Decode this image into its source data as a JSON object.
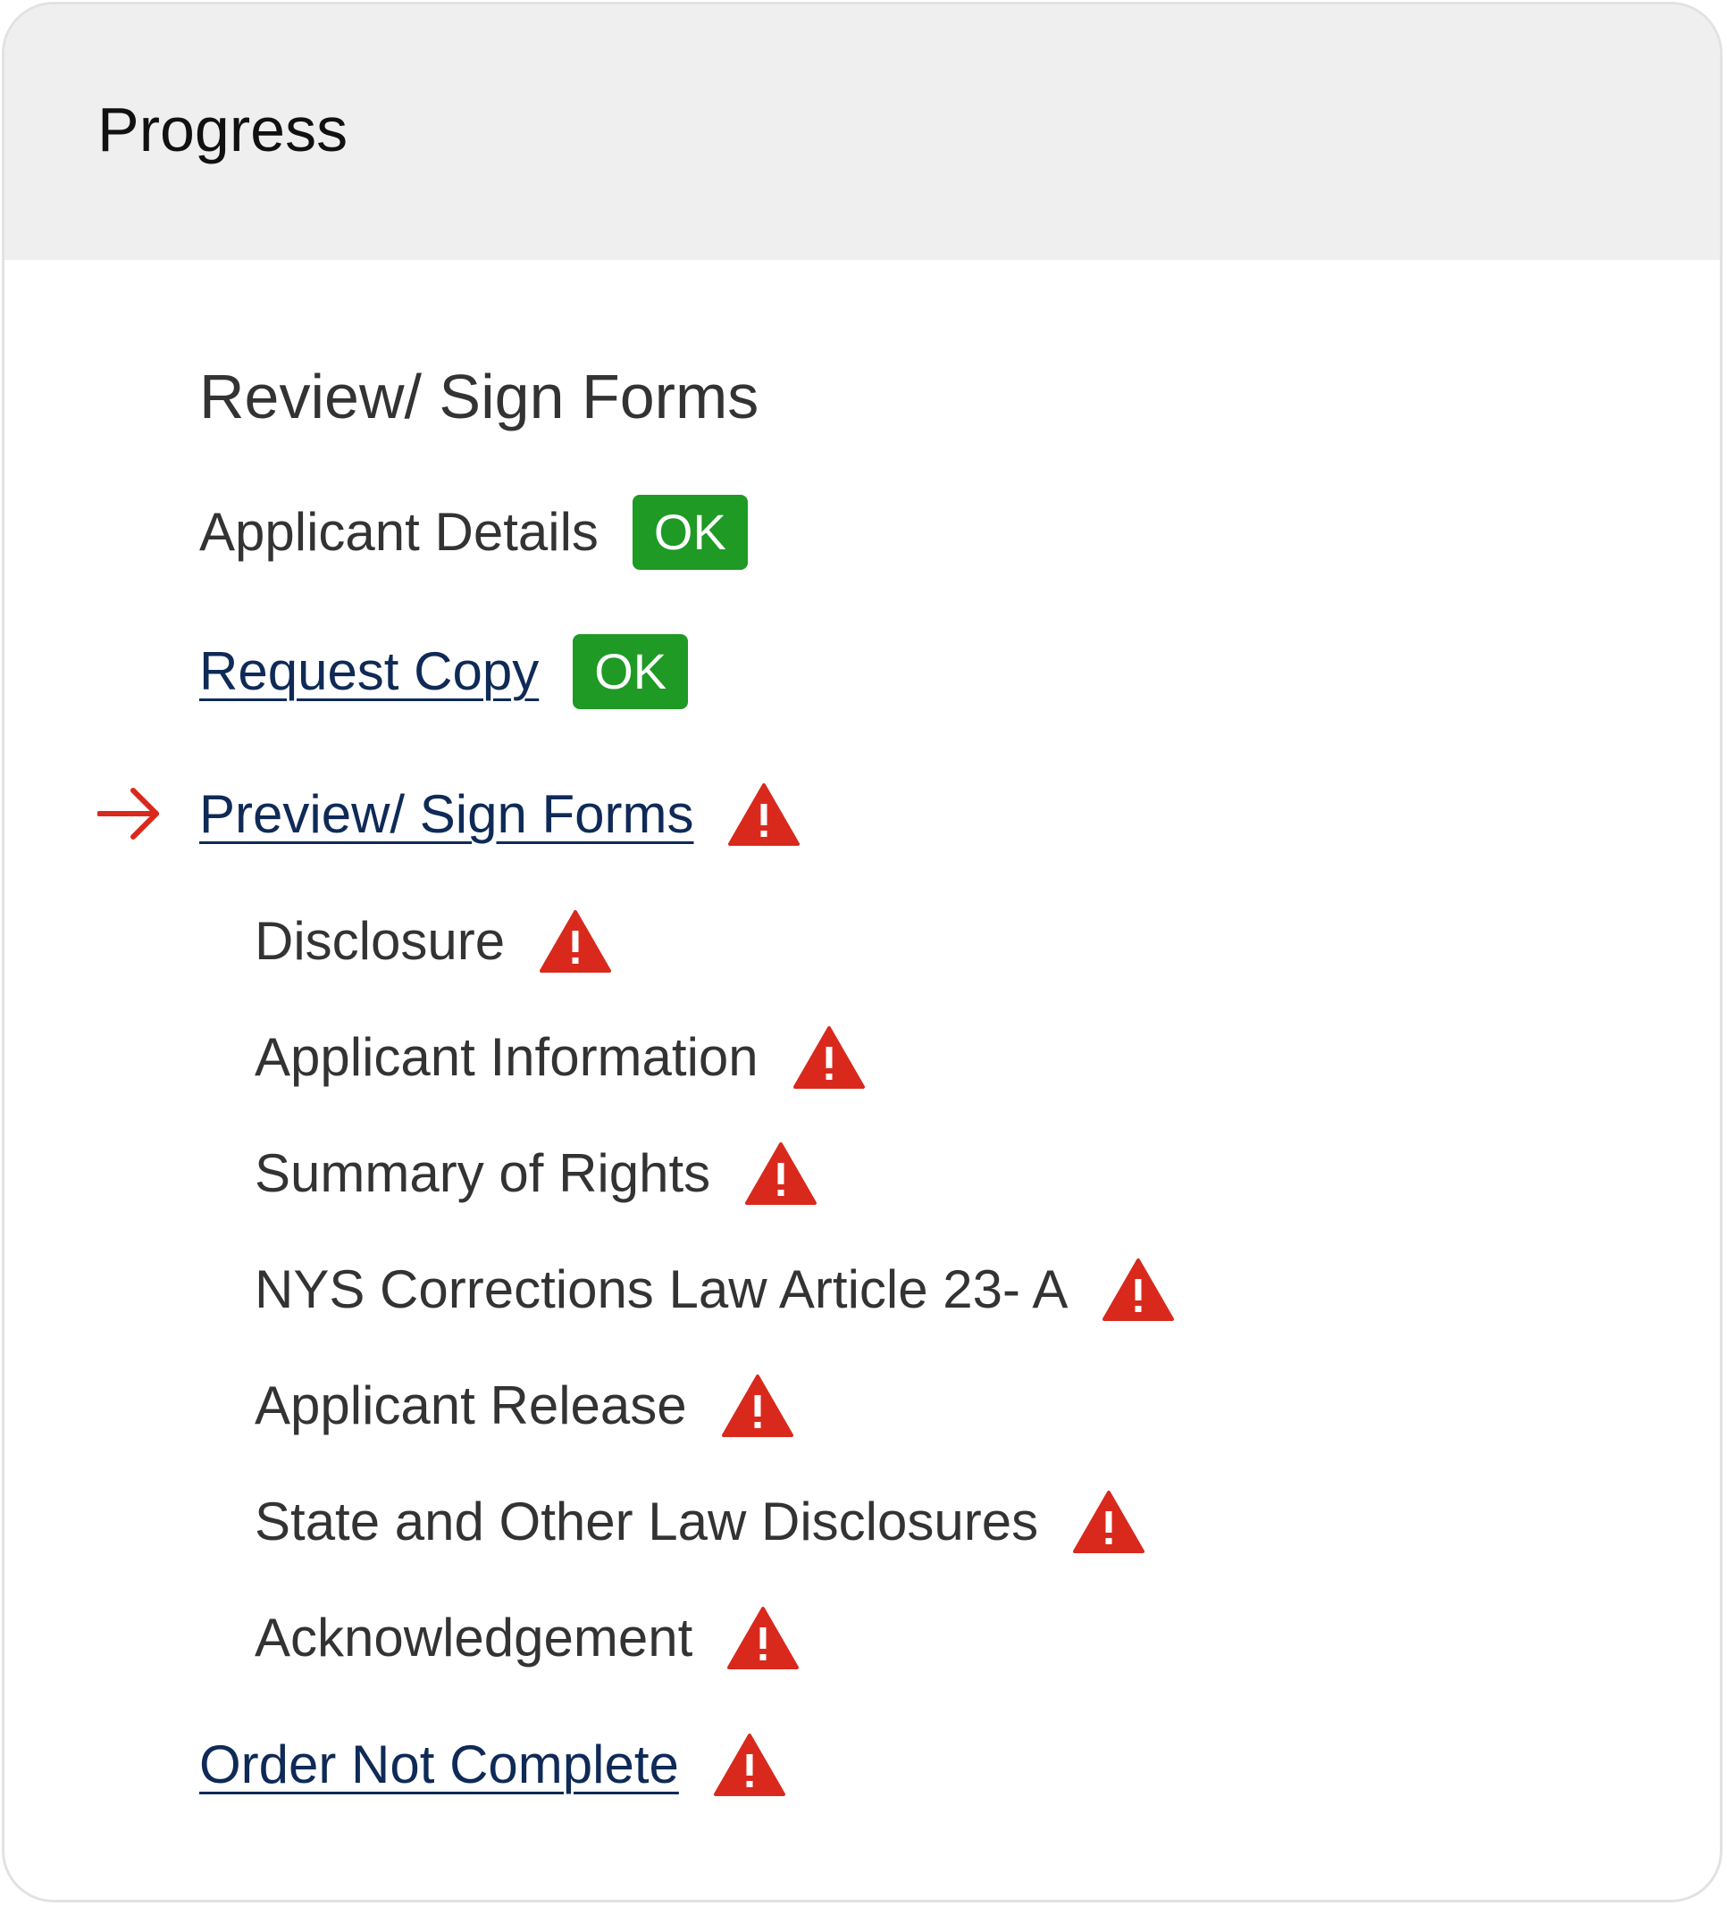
{
  "panel": {
    "title": "Progress"
  },
  "section": {
    "title": "Review/ Sign Forms"
  },
  "steps": [
    {
      "label": "Applicant Details",
      "status": "OK"
    },
    {
      "label": "Request Copy",
      "status": "OK"
    },
    {
      "label": "Preview/ Sign Forms",
      "status": "warning",
      "current": true
    },
    {
      "label": "Order Not Complete",
      "status": "warning"
    }
  ],
  "sub_steps": [
    {
      "label": "Disclosure",
      "status": "warning"
    },
    {
      "label": "Applicant Information",
      "status": "warning"
    },
    {
      "label": "Summary of Rights",
      "status": "warning"
    },
    {
      "label": "NYS Corrections Law Article 23- A",
      "status": "warning"
    },
    {
      "label": "Applicant Release",
      "status": "warning"
    },
    {
      "label": "State and Other Law Disclosures",
      "status": "warning"
    },
    {
      "label": "Acknowledgement",
      "status": "warning"
    }
  ],
  "icons": {
    "status_ok": "ok-badge",
    "status_warning": "warning-triangle-icon",
    "current_step": "arrow-right-icon"
  },
  "colors": {
    "header_bg": "#efefef",
    "ok_green": "#1e9a25",
    "warning_red": "#d9291c",
    "link_navy": "#0f2a57",
    "text": "#333333"
  }
}
